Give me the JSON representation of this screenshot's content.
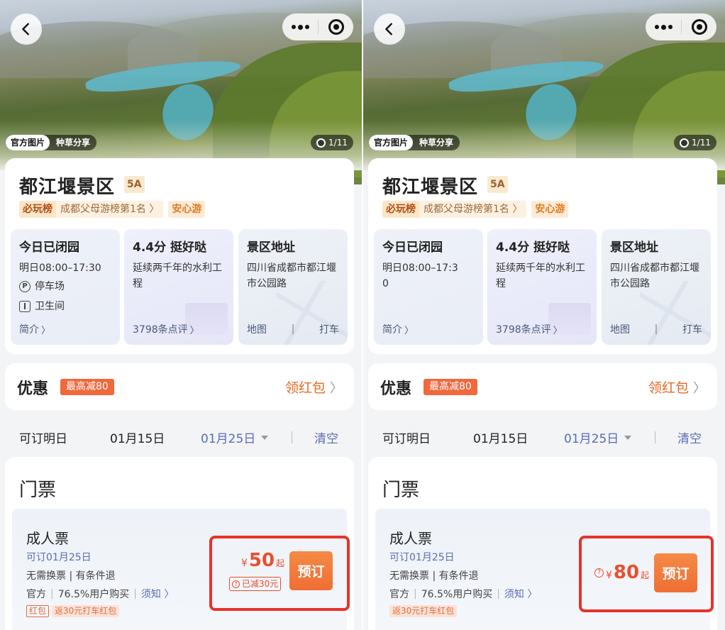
{
  "panels": [
    {
      "photo_tabs": [
        "官方图片",
        "种草分享"
      ],
      "photo_counter": "1/11",
      "title": "都江堰景区",
      "level": "5A",
      "rank": {
        "tag": "必玩榜",
        "text": "成都父母游榜第1名 〉",
        "extra": "安心游"
      },
      "hours": {
        "status": "今日已闭园",
        "tomorrow": "明日08:00–17:30",
        "parking": "停车场",
        "toilet": "卫生间",
        "intro": "简介"
      },
      "rating": {
        "score": "4.4分 挺好哒",
        "desc": "延续两千年的水利工程",
        "reviews": "3798条点评"
      },
      "address": {
        "label": "景区地址",
        "text": "四川省成都市都江堰市公园路",
        "map": "地图",
        "taxi": "打车"
      },
      "promo": {
        "label": "优惠",
        "badge": "最高减80",
        "action": "领红包"
      },
      "dates": {
        "label": "可订明日",
        "date1": "01月15日",
        "date2": "01月25日",
        "clear": "清空"
      },
      "tickets": {
        "section": "门票",
        "name": "成人票",
        "avail": "可订01月25日",
        "info1": "无需换票 | 有条件退",
        "source": "官方",
        "buy_rate": "76.5%用户购买",
        "notice": "须知 〉",
        "tag_red": "红包",
        "tag_fill": "返30元打车红包",
        "currency": "¥",
        "price": "50",
        "price_suffix": "起",
        "discount": "已减30元",
        "book": "预订"
      }
    },
    {
      "photo_tabs": [
        "官方图片",
        "种草分享"
      ],
      "photo_counter": "1/11",
      "title": "都江堰景区",
      "level": "5A",
      "rank": {
        "tag": "必玩榜",
        "text": "成都父母游榜第1名 〉",
        "extra": "安心游"
      },
      "hours": {
        "status": "今日已闭园",
        "tomorrow1": "明日08:00–17:3",
        "tomorrow2": "0",
        "intro": "简介"
      },
      "rating": {
        "score": "4.4分 挺好哒",
        "desc": "延续两千年的水利工程",
        "reviews": "3798条点评"
      },
      "address": {
        "label": "景区地址",
        "text": "四川省成都市都江堰市公园路",
        "map": "地图",
        "taxi": "打车"
      },
      "promo": {
        "label": "优惠",
        "badge": "最高减80",
        "action": "领红包"
      },
      "dates": {
        "label": "可订明日",
        "date1": "01月15日",
        "date2": "01月25日",
        "clear": "清空"
      },
      "tickets": {
        "section": "门票",
        "name": "成人票",
        "avail": "可订01月25日",
        "info1": "无需换票 | 有条件退",
        "source": "官方",
        "buy_rate": "76.5%用户购买",
        "notice": "须知 〉",
        "tag_fill": "返30元打车红包",
        "currency": "¥",
        "price": "80",
        "price_suffix": "起",
        "book": "预订"
      }
    }
  ],
  "colors": {
    "accent": "#ef6e35",
    "highlight": "#e8322a",
    "link": "#5a6cb5"
  }
}
